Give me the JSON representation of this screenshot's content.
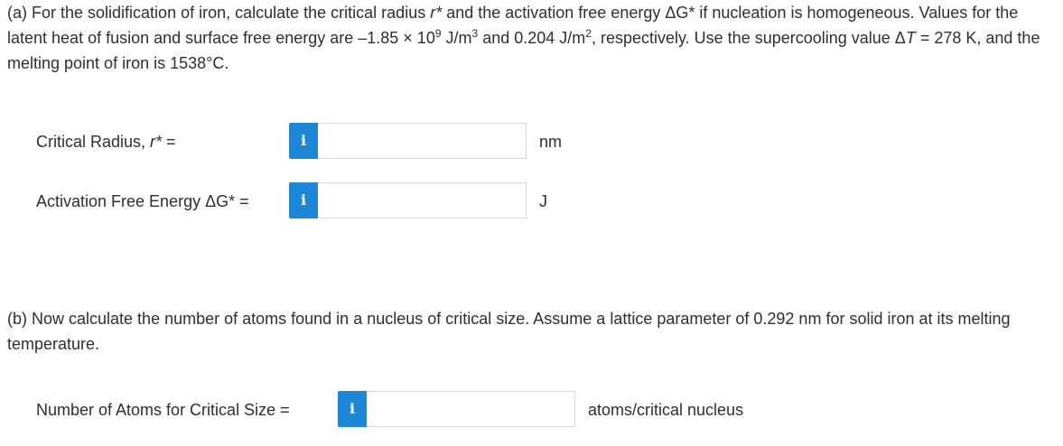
{
  "part_a": {
    "text_1": "(a) For the solidification of iron, calculate the critical radius ",
    "r_symbol": "r*",
    "text_2": " and the activation free energy ΔG* if nucleation is homogeneous. Values for the latent heat of fusion and surface free energy are –1.85 × 10",
    "exp_1": "9",
    "text_3": " J/m",
    "exp_2": "3",
    "text_4": " and 0.204 J/m",
    "exp_3": "2",
    "text_5": ", respectively. Use the supercooling value Δ",
    "t_symbol": "T",
    "text_6": " = 278 K, and the melting point of iron is 1538°C."
  },
  "fields": {
    "radius": {
      "label_prefix": "Critical Radius, ",
      "label_symbol": "r*",
      "label_suffix": " =",
      "info_glyph": "i",
      "value": "",
      "unit": "nm"
    },
    "energy": {
      "label": "Activation Free Energy ΔG* =",
      "info_glyph": "i",
      "value": "",
      "unit": "J"
    },
    "atoms": {
      "label": "Number of Atoms for Critical Size =",
      "info_glyph": "i",
      "value": "",
      "unit": "atoms/critical nucleus"
    }
  },
  "part_b": {
    "text": "(b) Now calculate the number of atoms found in a nucleus of critical size. Assume a lattice parameter of 0.292 nm for solid iron at its melting temperature."
  },
  "icons": {
    "info": "info-icon"
  },
  "colors": {
    "info_button": "#1e86d6",
    "text": "#2f2f2f",
    "input_border": "#d8d8d8"
  }
}
